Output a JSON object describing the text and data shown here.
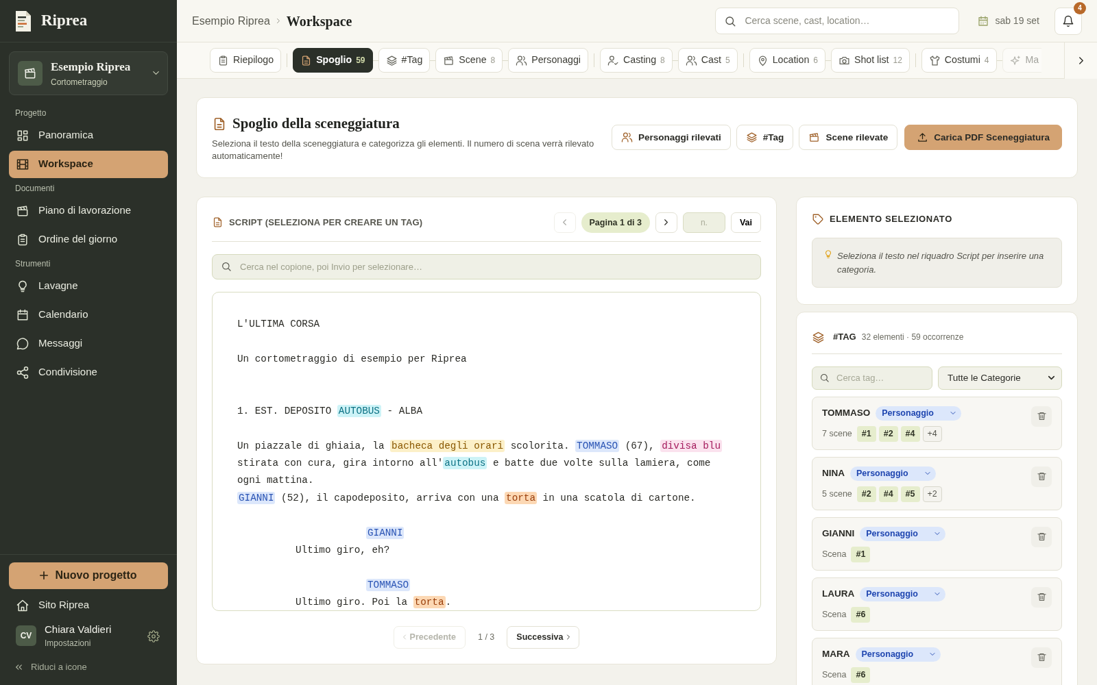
{
  "app": {
    "name": "Riprea"
  },
  "project": {
    "name": "Esempio Riprea",
    "type": "Cortometraggio"
  },
  "nav_sections": [
    {
      "title": "Progetto",
      "items": [
        {
          "label": "Panoramica",
          "selected": false
        },
        {
          "label": "Workspace",
          "selected": true
        }
      ]
    },
    {
      "title": "Documenti",
      "items": [
        {
          "label": "Piano di lavorazione",
          "selected": false
        },
        {
          "label": "Ordine del giorno",
          "selected": false
        }
      ]
    },
    {
      "title": "Strumenti",
      "items": [
        {
          "label": "Lavagne",
          "selected": false
        },
        {
          "label": "Calendario",
          "selected": false
        },
        {
          "label": "Messaggi",
          "selected": false
        },
        {
          "label": "Condivisione",
          "selected": false
        }
      ]
    }
  ],
  "new_project_button": "Nuovo progetto",
  "site_link": "Sito Riprea",
  "user": {
    "initials": "CV",
    "name": "Chiara Valdieri",
    "subtitle": "Impostazioni"
  },
  "collapse_link": "Riduci a icone",
  "breadcrumb": [
    {
      "label": "Esempio Riprea",
      "current": false
    },
    {
      "label": "Workspace",
      "current": true
    }
  ],
  "search": {
    "placeholder": "Cerca scene, cast, location…"
  },
  "date": "sab 19 set",
  "notifications": {
    "count": "4"
  },
  "tab_groups": [
    {
      "tabs": [
        {
          "label": "Riepilogo",
          "selected": false
        }
      ]
    },
    {
      "tabs": [
        {
          "label": "Spoglio",
          "count": "59",
          "selected": true
        },
        {
          "label": "#Tag",
          "selected": false
        },
        {
          "label": "Scene",
          "count": "8",
          "selected": false
        },
        {
          "label": "Personaggi",
          "selected": false
        }
      ]
    },
    {
      "tabs": [
        {
          "label": "Casting",
          "count": "8",
          "selected": false
        },
        {
          "label": "Cast",
          "count": "5",
          "selected": false
        }
      ]
    },
    {
      "tabs": [
        {
          "label": "Location",
          "count": "6",
          "selected": false
        },
        {
          "label": "Shot list",
          "count": "12",
          "selected": false
        }
      ]
    },
    {
      "tabs": [
        {
          "label": "Costumi",
          "count": "4",
          "selected": false
        },
        {
          "label": "Ma",
          "selected": false
        }
      ]
    }
  ],
  "breakdown_header": {
    "title": "Spoglio della sceneggiatura",
    "description": "Seleziona il testo della sceneggiatura e categorizza gli elementi. Il numero di scena verrà rilevato automaticamente!",
    "buttons": [
      {
        "label": "Personaggi rilevati",
        "primary": false
      },
      {
        "label": "#Tag",
        "primary": false
      },
      {
        "label": "Scene rilevate",
        "primary": false
      },
      {
        "label": "Carica PDF Sceneggiatura",
        "primary": true
      }
    ]
  },
  "script_panel": {
    "title": "SCRIPT (SELEZIONA PER CREARE UN TAG)",
    "prev_disabled": true,
    "page_label": "Pagina 1 di 3",
    "page_input_placeholder": "n.",
    "go_button": "Vai",
    "search_placeholder": "Cerca nel copione, poi Invio per selezionare…",
    "blocks": [
      {
        "kind": "title",
        "segments": [
          {
            "kind": "text",
            "text": "L'ULTIMA CORSA"
          }
        ]
      },
      {
        "kind": "subtitle",
        "segments": [
          {
            "kind": "text",
            "text": "Un cortometraggio di esempio per Riprea"
          }
        ]
      },
      {
        "kind": "scene_heading",
        "segments": [
          {
            "kind": "text",
            "text": "1. EST. DEPOSITO "
          },
          {
            "kind": "vehicle",
            "text": "AUTOBUS"
          },
          {
            "kind": "text",
            "text": " - ALBA"
          }
        ]
      },
      {
        "kind": "action",
        "segments": [
          {
            "kind": "text",
            "text": "Un piazzale di ghiaia, la "
          },
          {
            "kind": "set_dressing",
            "text": "bacheca degli orari"
          },
          {
            "kind": "text",
            "text": " scolorita. "
          },
          {
            "kind": "character",
            "text": "TOMMASO"
          },
          {
            "kind": "text",
            "text": " (67), "
          },
          {
            "kind": "costume",
            "text": "divisa blu"
          },
          {
            "kind": "break"
          },
          {
            "kind": "text",
            "text": "stirata con cura, gira intorno all'"
          },
          {
            "kind": "vehicle",
            "text": "autobus"
          },
          {
            "kind": "text",
            "text": " e batte due volte sulla lamiera, come"
          },
          {
            "kind": "break"
          },
          {
            "kind": "text",
            "text": "ogni mattina."
          },
          {
            "kind": "break"
          },
          {
            "kind": "character",
            "text": "GIANNI"
          },
          {
            "kind": "text",
            "text": " (52), il capodeposito, arriva con una "
          },
          {
            "kind": "prop",
            "text": "torta"
          },
          {
            "kind": "text",
            "text": " in una scatola di cartone."
          }
        ]
      },
      {
        "kind": "cue",
        "segments": [
          {
            "kind": "character",
            "text": "GIANNI"
          }
        ]
      },
      {
        "kind": "dialogue",
        "segments": [
          {
            "kind": "text",
            "text": "Ultimo giro, eh?"
          }
        ]
      },
      {
        "kind": "cue",
        "segments": [
          {
            "kind": "character",
            "text": "TOMMASO"
          }
        ]
      },
      {
        "kind": "dialogue",
        "segments": [
          {
            "kind": "text",
            "text": "Ultimo giro. Poi la "
          },
          {
            "kind": "prop",
            "text": "torta"
          },
          {
            "kind": "text",
            "text": "."
          }
        ]
      }
    ],
    "footer": {
      "prev": {
        "label": "Precedente",
        "disabled": true
      },
      "page": "1 / 3",
      "next": {
        "label": "Successiva",
        "disabled": false
      }
    }
  },
  "selected_element": {
    "title": "ELEMENTO SELEZIONATO",
    "hint": "Seleziona il testo nel riquadro Script per inserire una categoria."
  },
  "tags_panel": {
    "title": "#TAG",
    "summary": "32 elementi · 59 occorrenze",
    "search_placeholder": "Cerca tag…",
    "category_filter": "Tutte le Categorie",
    "items": [
      {
        "name": "TOMMASO",
        "category": "Personaggio",
        "scenes_label": "7 scene",
        "scenes": [
          "#1",
          "#2",
          "#4"
        ],
        "more": "+4"
      },
      {
        "name": "NINA",
        "category": "Personaggio",
        "scenes_label": "5 scene",
        "scenes": [
          "#2",
          "#4",
          "#5"
        ],
        "more": "+2"
      },
      {
        "name": "GIANNI",
        "category": "Personaggio",
        "scenes_label": "Scena",
        "scenes": [
          "#1"
        ]
      },
      {
        "name": "LAURA",
        "category": "Personaggio",
        "scenes_label": "Scena",
        "scenes": [
          "#6"
        ]
      },
      {
        "name": "MARA",
        "category": "Personaggio",
        "scenes_label": "Scena",
        "scenes": [
          "#6"
        ]
      }
    ]
  }
}
